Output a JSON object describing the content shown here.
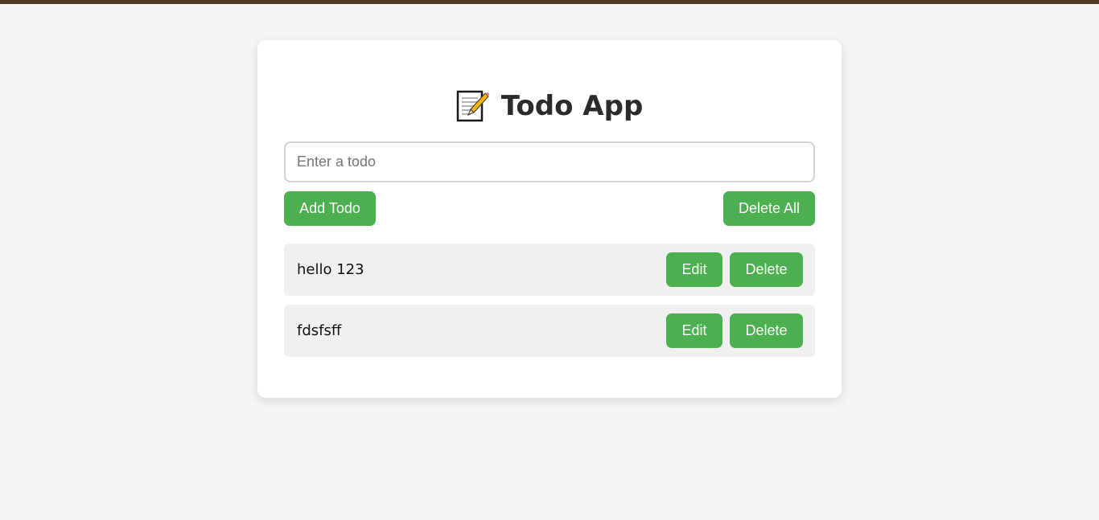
{
  "app": {
    "title": "Todo App",
    "title_icon": "memo-icon"
  },
  "input": {
    "value": "",
    "placeholder": "Enter a todo"
  },
  "actions": {
    "add_label": "Add Todo",
    "delete_all_label": "Delete All"
  },
  "todos": [
    {
      "text": "hello 123",
      "edit_label": "Edit",
      "delete_label": "Delete"
    },
    {
      "text": "fdsfsff",
      "edit_label": "Edit",
      "delete_label": "Delete"
    }
  ],
  "colors": {
    "accent": "#4caf50",
    "top_bar": "#4a3b22",
    "background": "#f5f5f5",
    "card": "#ffffff",
    "item_background": "#f0f0f0",
    "title_text": "#2b2b2b"
  }
}
